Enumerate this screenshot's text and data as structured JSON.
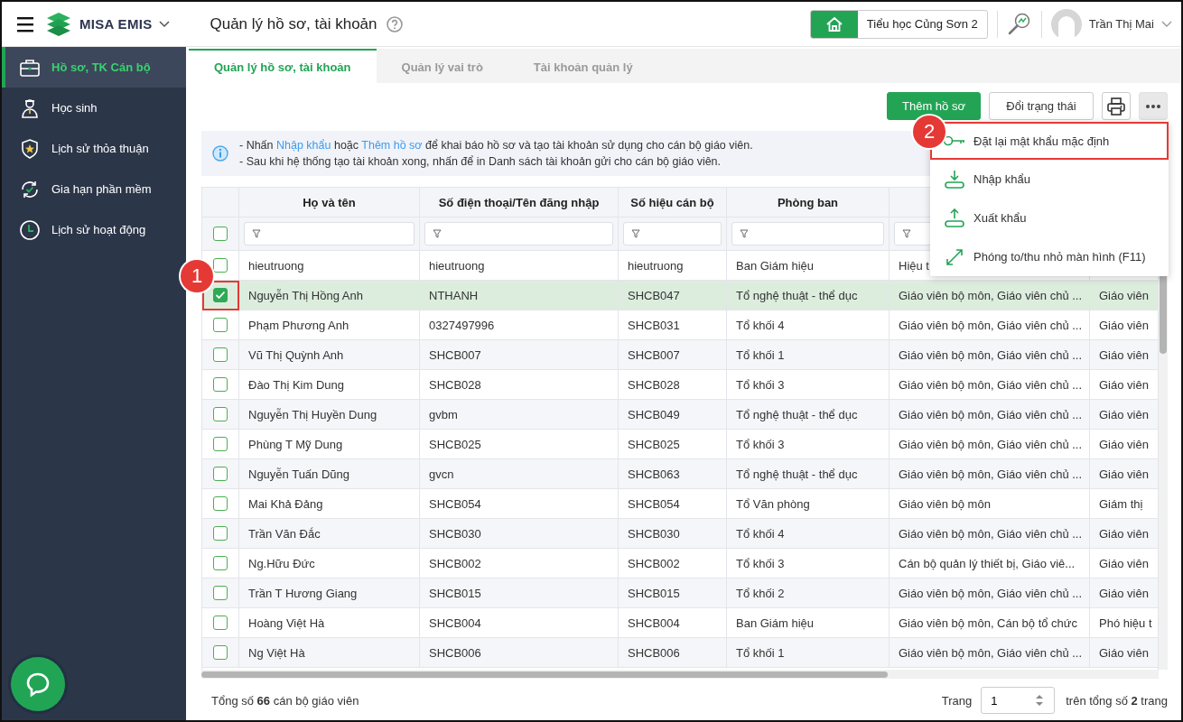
{
  "header": {
    "app_name": "MISA EMIS",
    "page_title": "Quản lý hồ sơ, tài khoản",
    "school": "Tiểu học Củng Sơn 2",
    "user": "Trần Thị Mai"
  },
  "sidebar": {
    "items": [
      {
        "label": "Hồ sơ, TK Cán bộ",
        "selected": true
      },
      {
        "label": "Học sinh",
        "selected": false
      },
      {
        "label": "Lịch sử thỏa thuận",
        "selected": false
      },
      {
        "label": "Gia hạn phần mềm",
        "selected": false
      },
      {
        "label": "Lịch sử hoạt động",
        "selected": false
      }
    ]
  },
  "tabs": [
    {
      "label": "Quản lý hồ sơ, tài khoản",
      "selected": true
    },
    {
      "label": "Quản lý vai trò",
      "selected": false
    },
    {
      "label": "Tài khoản quản lý",
      "selected": false
    }
  ],
  "toolbar": {
    "buttons": [
      {
        "kind": "primary",
        "label": "Thêm hồ sơ"
      },
      {
        "kind": "outline",
        "label": "Đổi trạng thái"
      },
      {
        "kind": "print"
      },
      {
        "kind": "more",
        "expanded": true
      }
    ]
  },
  "info": {
    "lines": [
      [
        {
          "kind": "text",
          "text": "- Nhấn "
        },
        {
          "kind": "link",
          "text": "Nhập khẩu"
        },
        {
          "kind": "text",
          "text": " hoặc "
        },
        {
          "kind": "link",
          "text": "Thêm hồ sơ"
        },
        {
          "kind": "text",
          "text": " để khai báo hồ sơ và tạo tài khoản sử dụng cho cán bộ giáo viên."
        }
      ],
      [
        {
          "kind": "text",
          "text": "- Sau khi hệ thống tạo tài khoản xong, nhấn để in Danh sách tài khoản gửi cho cán bộ giáo viên."
        }
      ]
    ]
  },
  "table": {
    "header_checked": false,
    "columns": [
      {
        "title": "Họ và tên"
      },
      {
        "title": "Số điện thoại/Tên đăng nhập"
      },
      {
        "title": "Số hiệu cán bộ"
      },
      {
        "title": "Phòng ban"
      },
      {},
      {}
    ],
    "rows": [
      {
        "cells": [
          "hieutruong",
          "hieutruong",
          "hieutruong",
          "Ban Giám hiệu",
          "Hiệu t"
        ],
        "checked": false,
        "selected": false,
        "highlighted": false
      },
      {
        "cells": [
          "Nguyễn Thị Hồng Anh",
          "NTHANH",
          "SHCB047",
          "Tổ nghệ thuật - thể dục",
          "Giáo viên bộ môn, Giáo viên chủ ...",
          "Giáo viên"
        ],
        "checked": true,
        "selected": true,
        "highlighted": true
      },
      {
        "cells": [
          "Phạm Phương Anh",
          "0327497996",
          "SHCB031",
          "Tổ khối 4",
          "Giáo viên bộ môn, Giáo viên chủ ...",
          "Giáo viên"
        ],
        "checked": false,
        "selected": false,
        "highlighted": false
      },
      {
        "cells": [
          "Vũ Thị Quỳnh Anh",
          "SHCB007",
          "SHCB007",
          "Tổ khối 1",
          "Giáo viên bộ môn, Giáo viên chủ ...",
          "Giáo viên"
        ],
        "checked": false,
        "selected": false,
        "highlighted": false
      },
      {
        "cells": [
          "Đào Thị Kim Dung",
          "SHCB028",
          "SHCB028",
          "Tổ khối 3",
          "Giáo viên bộ môn, Giáo viên chủ ...",
          "Giáo viên"
        ],
        "checked": false,
        "selected": false,
        "highlighted": false
      },
      {
        "cells": [
          "Nguyễn Thị Huyền Dung",
          "gvbm",
          "SHCB049",
          "Tổ nghệ thuật - thể dục",
          "Giáo viên bộ môn, Giáo viên chủ ...",
          "Giáo viên"
        ],
        "checked": false,
        "selected": false,
        "highlighted": false
      },
      {
        "cells": [
          "Phùng T Mỹ Dung",
          "SHCB025",
          "SHCB025",
          "Tổ khối 3",
          "Giáo viên bộ môn, Giáo viên chủ ...",
          "Giáo viên"
        ],
        "checked": false,
        "selected": false,
        "highlighted": false
      },
      {
        "cells": [
          "Nguyễn Tuấn Dũng",
          "gvcn",
          "SHCB063",
          "Tổ nghệ thuật - thể dục",
          "Giáo viên bộ môn, Giáo viên chủ ...",
          "Giáo viên"
        ],
        "checked": false,
        "selected": false,
        "highlighted": false
      },
      {
        "cells": [
          "Mai Khả Đảng",
          "SHCB054",
          "SHCB054",
          "Tổ Văn phòng",
          "Giáo viên bộ môn",
          "Giám thị"
        ],
        "checked": false,
        "selected": false,
        "highlighted": false
      },
      {
        "cells": [
          "Trần Văn Đắc",
          "SHCB030",
          "SHCB030",
          "Tổ khối 4",
          "Giáo viên bộ môn, Giáo viên chủ ...",
          "Giáo viên"
        ],
        "checked": false,
        "selected": false,
        "highlighted": false
      },
      {
        "cells": [
          "Ng.Hữu Đức",
          "SHCB002",
          "SHCB002",
          "Tổ khối 3",
          "Cán bộ quản lý thiết bị, Giáo viê...",
          "Giáo viên"
        ],
        "checked": false,
        "selected": false,
        "highlighted": false
      },
      {
        "cells": [
          "Trần T Hương Giang",
          "SHCB015",
          "SHCB015",
          "Tổ khối 2",
          "Giáo viên bộ môn, Giáo viên chủ ...",
          "Giáo viên"
        ],
        "checked": false,
        "selected": false,
        "highlighted": false
      },
      {
        "cells": [
          "Hoàng Việt Hà",
          "SHCB004",
          "SHCB004",
          "Ban Giám hiệu",
          "Giáo viên bộ môn, Cán bộ tổ chức",
          "Phó hiệu t"
        ],
        "checked": false,
        "selected": false,
        "highlighted": false
      },
      {
        "cells": [
          "Ng Việt Hà",
          "SHCB006",
          "SHCB006",
          "Tổ khối 1",
          "Giáo viên bộ môn, Giáo viên chủ ...",
          "Giáo viên"
        ],
        "checked": false,
        "selected": false,
        "highlighted": false
      }
    ]
  },
  "footer": {
    "total": "Tổng số **66** cán bộ giáo viên",
    "page_label": "Trang",
    "page_value": "1",
    "page_total": "trên tổng số **2** trang"
  },
  "menu": {
    "items": [
      {
        "label": "Đặt lại mật khẩu mặc định",
        "highlighted": true
      },
      {
        "label": "Nhập khẩu",
        "highlighted": false
      },
      {
        "label": "Xuất khẩu",
        "highlighted": false
      },
      {
        "label": "Phóng to/thu nhỏ màn hình (F11)",
        "highlighted": false
      }
    ]
  },
  "annotations": [
    {
      "label": "1"
    },
    {
      "label": "2"
    }
  ]
}
